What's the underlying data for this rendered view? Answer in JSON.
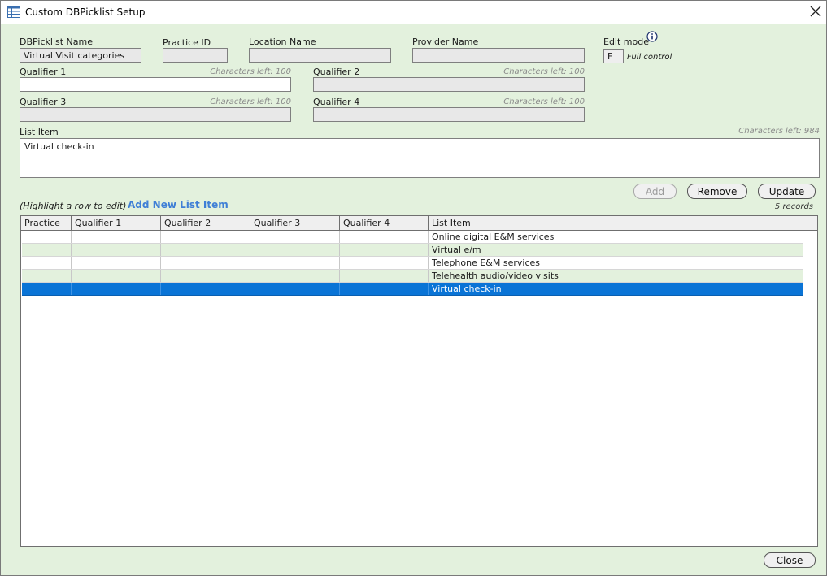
{
  "window": {
    "title": "Custom DBPicklist Setup"
  },
  "form": {
    "dbpicklist_name": {
      "label": "DBPicklist Name",
      "value": "Virtual Visit categories"
    },
    "practice_id": {
      "label": "Practice ID",
      "value": ""
    },
    "location_name": {
      "label": "Location Name",
      "value": ""
    },
    "provider_name": {
      "label": "Provider Name",
      "value": ""
    },
    "edit_mode": {
      "label": "Edit mode",
      "value": "F",
      "description": "Full control"
    },
    "qualifier1": {
      "label": "Qualifier 1",
      "value": "",
      "chars_left": "Characters left: 100"
    },
    "qualifier2": {
      "label": "Qualifier 2",
      "value": "",
      "chars_left": "Characters left: 100"
    },
    "qualifier3": {
      "label": "Qualifier 3",
      "value": "",
      "chars_left": "Characters left: 100"
    },
    "qualifier4": {
      "label": "Qualifier 4",
      "value": "",
      "chars_left": "Characters left: 100"
    },
    "list_item": {
      "label": "List Item",
      "value": "Virtual check-in",
      "chars_left": "Characters left: 984"
    }
  },
  "actions": {
    "add": "Add",
    "remove": "Remove",
    "update": "Update",
    "close": "Close"
  },
  "list": {
    "hint": "(Highlight a row to edit)",
    "add_new_link": "Add New List Item",
    "record_count": "5 records",
    "columns": [
      "Practice",
      "Qualifier 1",
      "Qualifier 2",
      "Qualifier 3",
      "Qualifier 4",
      "List Item"
    ],
    "rows": [
      {
        "practice": "",
        "q1": "",
        "q2": "",
        "q3": "",
        "q4": "",
        "item": "Online digital E&M services"
      },
      {
        "practice": "",
        "q1": "",
        "q2": "",
        "q3": "",
        "q4": "",
        "item": "Virtual e/m"
      },
      {
        "practice": "",
        "q1": "",
        "q2": "",
        "q3": "",
        "q4": "",
        "item": "Telephone E&M services"
      },
      {
        "practice": "",
        "q1": "",
        "q2": "",
        "q3": "",
        "q4": "",
        "item": "Telehealth audio/video visits"
      },
      {
        "practice": "",
        "q1": "",
        "q2": "",
        "q3": "",
        "q4": "",
        "item": "Virtual check-in",
        "selected": true
      }
    ]
  },
  "colors": {
    "panel_bg": "#e3f1dd",
    "selection": "#0a74d6",
    "link": "#3f7fd6"
  },
  "icons": {
    "app": "table-icon",
    "close": "close-icon",
    "info": "info-icon"
  }
}
